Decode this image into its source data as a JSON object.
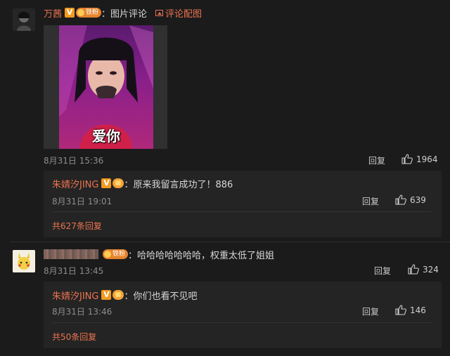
{
  "comment1": {
    "username": "万茜",
    "badge_v": "V",
    "badge_fan": "铁粉",
    "text": "：图片评论",
    "link_label": "评论配图",
    "image_caption": "爱你",
    "date": "8月31日 15:36",
    "reply_label": "回复",
    "likes": "1964",
    "reply": {
      "username": "朱婧汐JING",
      "badge_v": "V",
      "text": "：原来我留言成功了！886",
      "date": "8月31日 19:01",
      "reply_label": "回复",
      "likes": "639"
    },
    "more_replies": "共627条回复"
  },
  "comment2": {
    "badge_fan": "铁粉",
    "text": "：哈哈哈哈哈哈哈，权重太低了姐姐",
    "date": "8月31日 13:45",
    "reply_label": "回复",
    "likes": "324",
    "reply": {
      "username": "朱婧汐JING",
      "badge_v": "V",
      "text": "：你们也看不见吧",
      "date": "8月31日 13:46",
      "reply_label": "回复",
      "likes": "146"
    },
    "more_replies": "共50条回复"
  },
  "colors": {
    "accent": "#eb7350",
    "background": "#1b1b1b",
    "reply_bg": "#242424",
    "muted": "#8d8d8d"
  },
  "icons": {
    "like": "thumbs-up-icon",
    "picture": "picture-icon"
  }
}
